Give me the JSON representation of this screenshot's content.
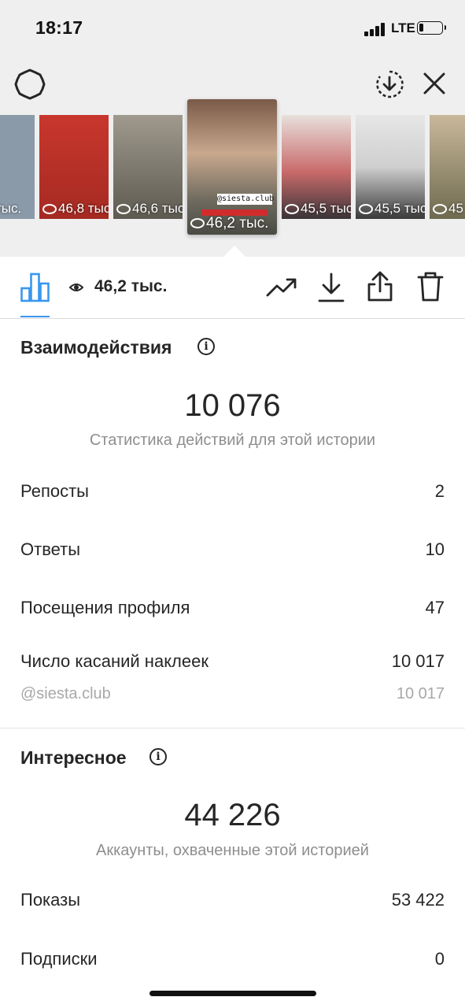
{
  "status_bar": {
    "time": "18:17",
    "network": "LTE"
  },
  "thumbnails": [
    {
      "views": "тыс.",
      "color": "#8a9aa8"
    },
    {
      "views": "46,8 тыс.",
      "color": "#c8372d"
    },
    {
      "views": "46,6 тыс.",
      "color": "#7e7a6e"
    },
    {
      "views": "46,2 тыс.",
      "color": "#6e6a5e",
      "selected": true,
      "caption": "@siesta.club"
    },
    {
      "views": "45,5 тыс.",
      "color": "#b8a8a8"
    },
    {
      "views": "45,5 тыс.",
      "color": "#d9d9d9"
    },
    {
      "views": "45",
      "color": "#90886a"
    }
  ],
  "tabbar": {
    "views": "46,2 тыс."
  },
  "interactions": {
    "title": "Взаимодействия",
    "total": "10 076",
    "caption": "Статистика действий для этой истории",
    "rows": [
      {
        "label": "Репосты",
        "value": "2"
      },
      {
        "label": "Ответы",
        "value": "10"
      },
      {
        "label": "Посещения профиля",
        "value": "47"
      },
      {
        "label": "Число касаний наклеек",
        "value": "10 017"
      }
    ],
    "sub_row": {
      "label": "@siesta.club",
      "value": "10 017"
    }
  },
  "discovery": {
    "title": "Интересное",
    "total": "44 226",
    "caption": "Аккаунты, охваченные этой историей",
    "rows": [
      {
        "label": "Показы",
        "value": "53 422"
      },
      {
        "label": "Подписки",
        "value": "0"
      }
    ]
  },
  "colors": {
    "accent": "#3897f0",
    "text": "#262626",
    "muted": "#8e8e8e"
  }
}
